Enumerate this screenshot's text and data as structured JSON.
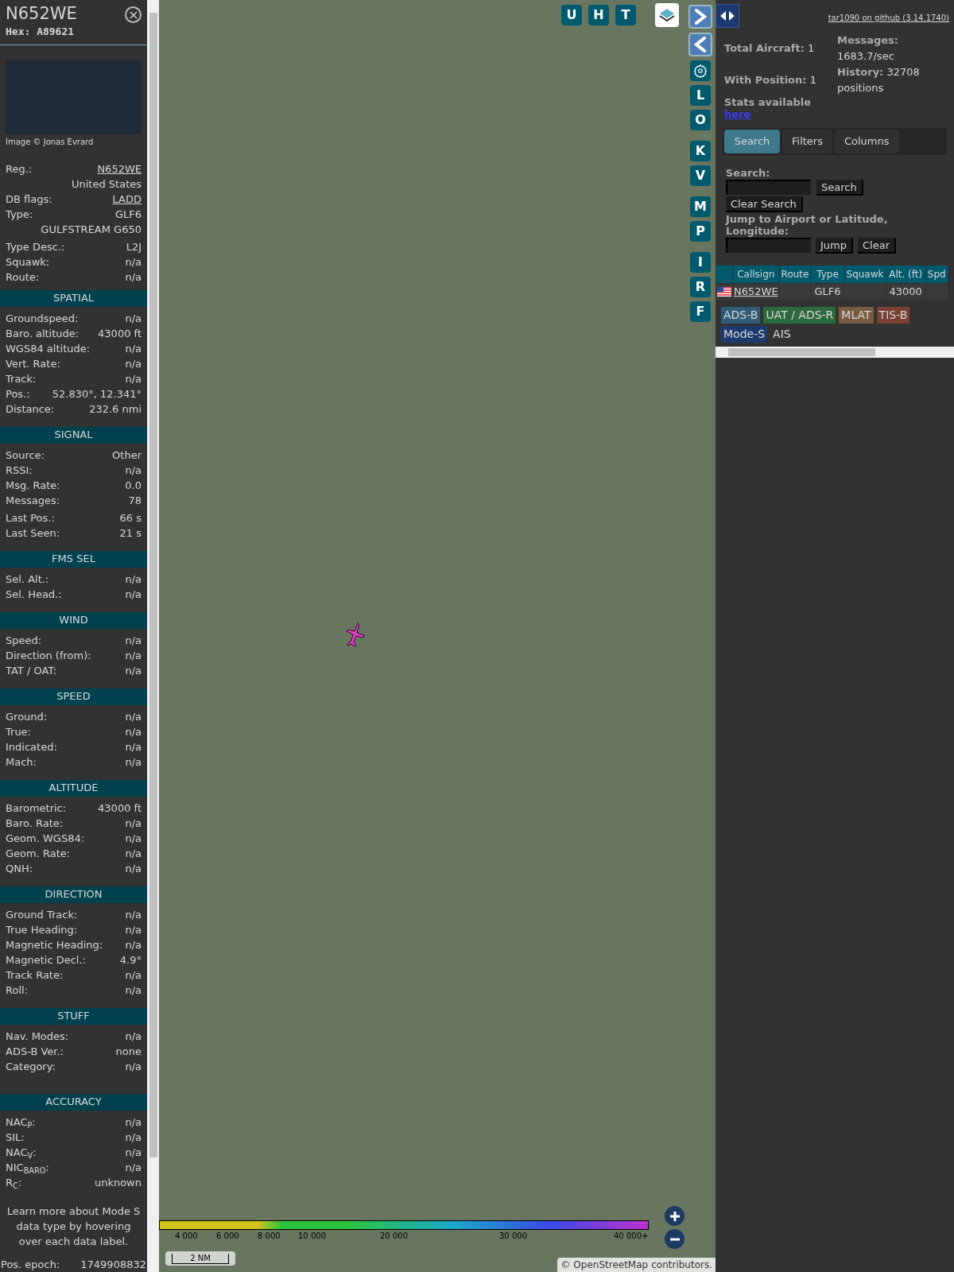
{
  "aircraft": {
    "title": "N652WE",
    "hex": "Hex: A89621",
    "photo_caption": "Image © Jonas Evrard",
    "info": [
      {
        "label": "Reg.:",
        "value": "N652WE",
        "link": true
      },
      {
        "value": "United States",
        "link": false
      },
      {
        "label": "DB flags:",
        "value": "LADD",
        "link": true
      },
      {
        "label": "Type:",
        "value": "GLF6",
        "link": false
      },
      {
        "value": "GULFSTREAM G650",
        "link": false
      },
      {
        "label": "Type Desc.:",
        "value": "L2J",
        "link": false
      },
      {
        "label": "Squawk:",
        "value": "n/a",
        "link": false
      },
      {
        "label": "Route:",
        "value": "n/a",
        "link": false
      }
    ]
  },
  "sections": [
    {
      "title": "SPATIAL",
      "rows": [
        [
          "Groundspeed:",
          "n/a"
        ],
        [
          "Baro. altitude:",
          "43000 ft"
        ],
        [
          "WGS84 altitude:",
          "n/a"
        ],
        [
          "Vert. Rate:",
          "n/a"
        ],
        [
          "Track:",
          "n/a"
        ],
        [
          "Pos.:",
          "52.830°, 12.341°"
        ],
        [
          "Distance:",
          "232.6 nmi"
        ]
      ]
    },
    {
      "title": "SIGNAL",
      "rows": [
        [
          "Source:",
          "Other"
        ],
        [
          "RSSI:",
          "n/a"
        ],
        [
          "Msg. Rate:",
          "0.0"
        ],
        [
          "Messages:",
          "78"
        ],
        [
          "Last Pos.:",
          "66 s"
        ],
        [
          "Last Seen:",
          "21 s"
        ]
      ]
    },
    {
      "title": "FMS SEL",
      "rows": [
        [
          "Sel. Alt.:",
          "n/a"
        ],
        [
          "Sel. Head.:",
          "n/a"
        ]
      ]
    },
    {
      "title": "WIND",
      "rows": [
        [
          "Speed:",
          "n/a"
        ],
        [
          "Direction (from):",
          "n/a"
        ],
        [
          "TAT / OAT:",
          "n/a"
        ]
      ]
    },
    {
      "title": "SPEED",
      "rows": [
        [
          "Ground:",
          "n/a"
        ],
        [
          "True:",
          "n/a"
        ],
        [
          "Indicated:",
          "n/a"
        ],
        [
          "Mach:",
          "n/a"
        ]
      ]
    },
    {
      "title": "ALTITUDE",
      "rows": [
        [
          "Barometric:",
          "43000 ft"
        ],
        [
          "Baro. Rate:",
          "n/a"
        ],
        [
          "Geom. WGS84:",
          "n/a"
        ],
        [
          "Geom. Rate:",
          "n/a"
        ],
        [
          "QNH:",
          "n/a"
        ]
      ]
    },
    {
      "title": "DIRECTION",
      "rows": [
        [
          "Ground Track:",
          "n/a"
        ],
        [
          "True Heading:",
          "n/a"
        ],
        [
          "Magnetic Heading:",
          "n/a"
        ],
        [
          "Magnetic Decl.:",
          "4.9°"
        ],
        [
          "Track Rate:",
          "n/a"
        ],
        [
          "Roll:",
          "n/a"
        ]
      ]
    },
    {
      "title": "STUFF",
      "rows": [
        [
          "Nav. Modes:",
          "n/a"
        ],
        [
          "ADS-B Ver.:",
          "none"
        ],
        [
          "Category:",
          "n/a"
        ]
      ]
    },
    {
      "title": "ACCURACY",
      "rows": [
        [
          "NAC$_{P}$:",
          "n/a"
        ],
        [
          "SIL:",
          "n/a"
        ],
        [
          "NAC$_{V}$:",
          "n/a"
        ],
        [
          "NIC$_{BARO}$:",
          "n/a"
        ],
        [
          "R$_{C}$:",
          "unknown"
        ]
      ]
    }
  ],
  "note": "Learn more about Mode S data type by hovering over each data label.",
  "epoch": {
    "label": "Pos. epoch:",
    "value": "1749908832"
  },
  "map": {
    "top_buttons": [
      "U",
      "H",
      "T"
    ],
    "side_buttons": [
      {
        "kind": "next"
      },
      {
        "kind": "prev"
      },
      {
        "kind": "settings"
      },
      {
        "kind": "letter",
        "label": "L"
      },
      {
        "kind": "letter",
        "label": "O"
      },
      {
        "kind": "letter",
        "label": "K"
      },
      {
        "kind": "letter",
        "label": "V"
      },
      {
        "kind": "letter",
        "label": "M"
      },
      {
        "kind": "letter",
        "label": "P"
      },
      {
        "kind": "letter",
        "label": "I"
      },
      {
        "kind": "letter",
        "label": "R"
      },
      {
        "kind": "letter",
        "label": "F"
      }
    ],
    "legend_ticks": [
      "4 000",
      "6 000",
      "8 000",
      "10 000",
      "20 000",
      "30 000",
      "40 000+"
    ],
    "scale": "2 NM",
    "attribution_symbol": "©",
    "attribution_link": "OpenStreetMap",
    "attribution_rest": "contributors."
  },
  "panel": {
    "github": "tar1090 on github (3.14.1740)",
    "stats": [
      {
        "label": "Total Aircraft:",
        "value": "1"
      },
      {
        "label": "Messages:",
        "value": "1683.7/sec"
      },
      {
        "label": "With Position:",
        "value": "1"
      },
      {
        "label": "History:",
        "value": "32708 positions"
      }
    ],
    "stats_text": "Stats available",
    "stats_link": "here",
    "tabs": [
      {
        "label": "Search",
        "selected": true
      },
      {
        "label": "Filters",
        "selected": false
      },
      {
        "label": "Columns",
        "selected": false
      }
    ],
    "search_label": "Search:",
    "search_button": "Search",
    "clear_search": "Clear Search",
    "jump_label": "Jump to Airport or Latitude, Longitude:",
    "jump_button": "Jump",
    "clear_button": "Clear",
    "columns": [
      "Callsign",
      "Route",
      "Type",
      "Squawk",
      "Alt. (ft)",
      "Spd"
    ],
    "rows": [
      {
        "callsign": "N652WE",
        "type": "GLF6",
        "alt": "43000"
      }
    ],
    "sources": [
      {
        "label": "ADS-B",
        "color": "#2f5b78"
      },
      {
        "label": "UAT / ADS-R",
        "color": "#2c6a3c"
      },
      {
        "label": "MLAT",
        "color": "#7a5b40"
      },
      {
        "label": "TIS-B",
        "color": "#7a3f33"
      },
      {
        "label": "Mode-S",
        "color": "#1d3a6e"
      },
      {
        "label": "AIS",
        "color": "#333333"
      }
    ]
  }
}
